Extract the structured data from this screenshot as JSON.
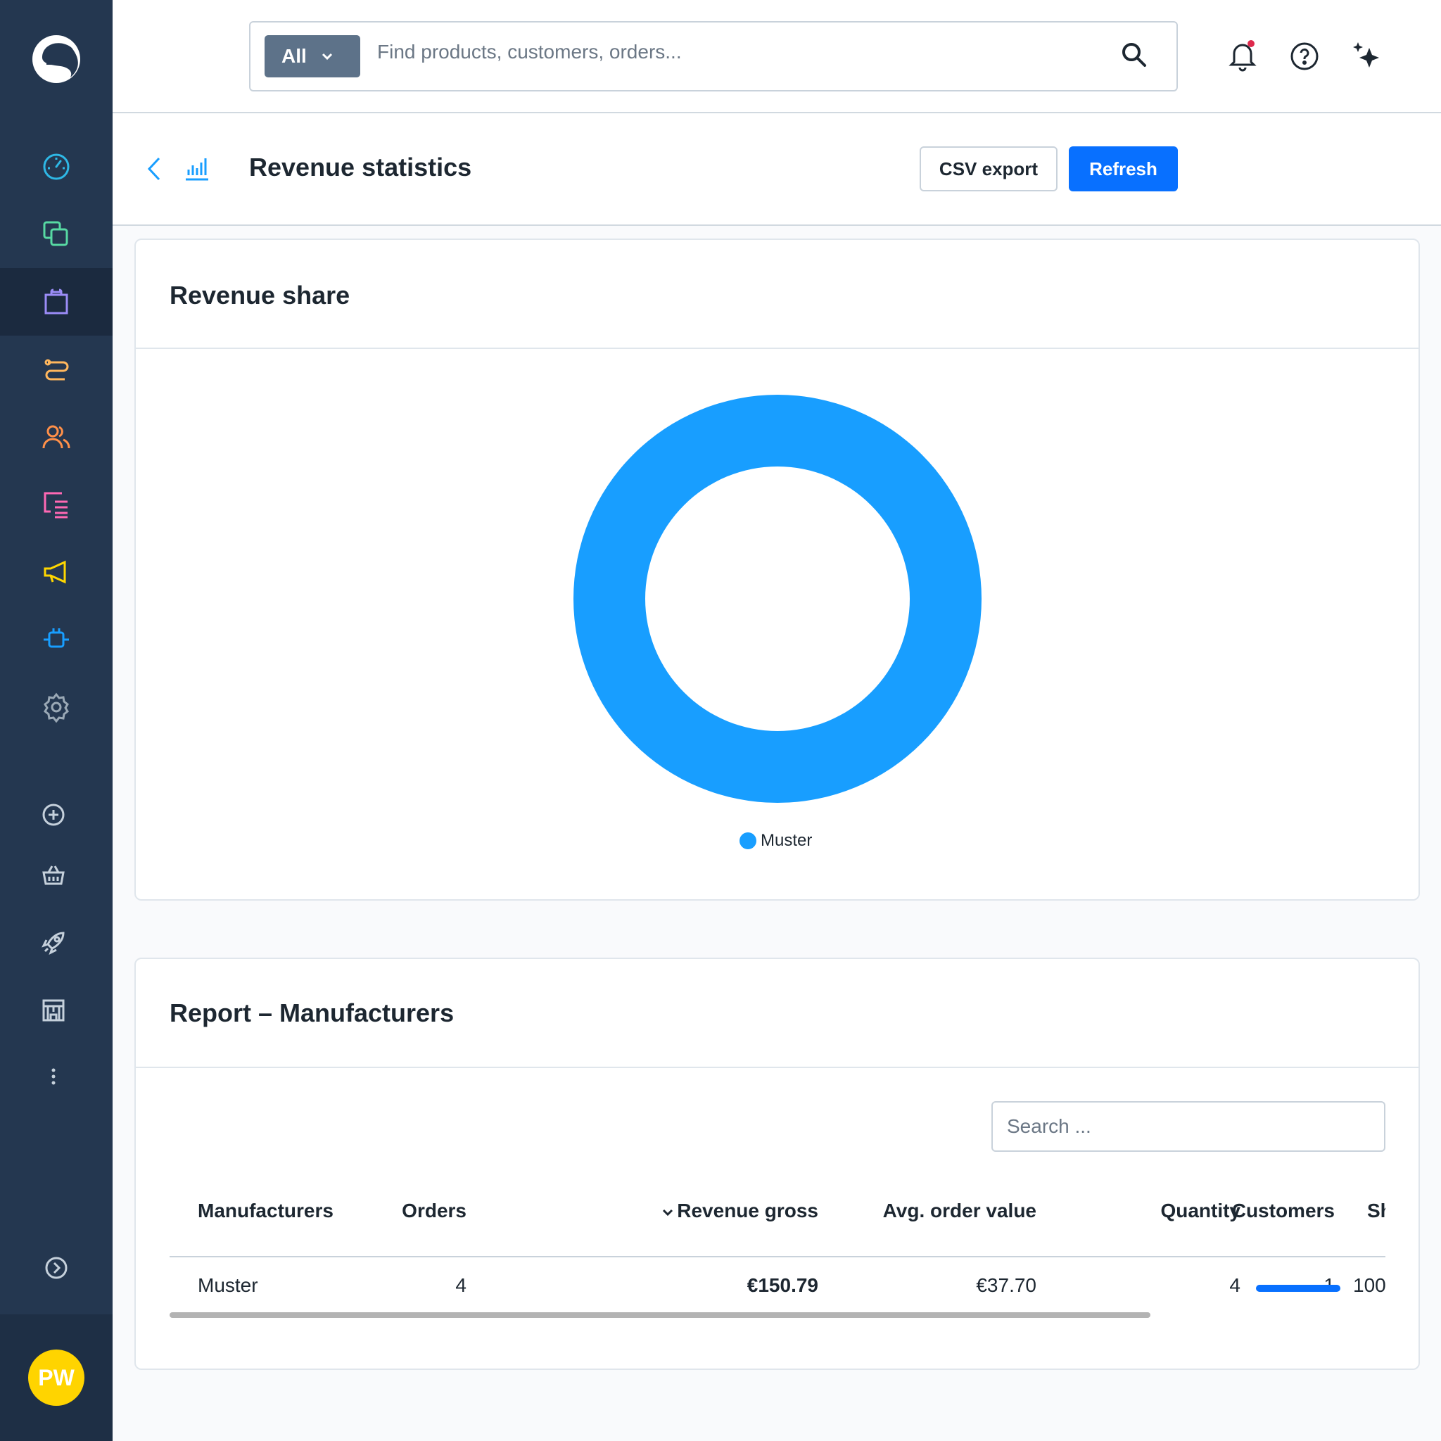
{
  "sidebar": {
    "nav_items": [
      {
        "name": "dashboard-icon",
        "color": "#2eb8e6"
      },
      {
        "name": "catalogues-icon",
        "color": "#57d9a3"
      },
      {
        "name": "orders-icon",
        "color": "#9b8cf7"
      },
      {
        "name": "customers-link-icon",
        "color": "#ffb75d"
      },
      {
        "name": "customers-icon",
        "color": "#ff9049"
      },
      {
        "name": "content-icon",
        "color": "#ff68b4"
      },
      {
        "name": "marketing-icon",
        "color": "#ffd700"
      },
      {
        "name": "extensions-icon",
        "color": "#189eff"
      },
      {
        "name": "settings-icon",
        "color": "#9aa8b5"
      }
    ],
    "sales_channels": [
      "add-sales-channel-icon",
      "basket-icon",
      "rocket-icon",
      "storefront-icon",
      "more-icon"
    ],
    "avatar_initials": "PW"
  },
  "topbar": {
    "search_type": "All",
    "search_placeholder": "Find products, customers, orders..."
  },
  "header": {
    "title": "Revenue statistics",
    "csv_export": "CSV export",
    "refresh": "Refresh"
  },
  "revenue_share": {
    "title": "Revenue share",
    "legend": "Muster"
  },
  "chart_data": {
    "type": "pie",
    "categories": [
      "Muster"
    ],
    "values": [
      150.79
    ],
    "colors": [
      "#189eff"
    ],
    "donut": true,
    "legend_position": "bottom"
  },
  "report": {
    "title": "Report – Manufacturers",
    "search_placeholder": "Search ...",
    "columns": [
      "Manufacturers",
      "Orders",
      "Revenue gross",
      "Avg. order value",
      "Quantity",
      "Customers",
      "Sh"
    ],
    "sort_indicator": "⌄",
    "rows": [
      {
        "manufacturer": "Muster",
        "orders": "4",
        "revenue_gross": "€150.79",
        "avg_order_value": "€37.70",
        "quantity": "4",
        "customers": "1",
        "share_text": "100",
        "share_fraction": 1.0
      }
    ]
  }
}
